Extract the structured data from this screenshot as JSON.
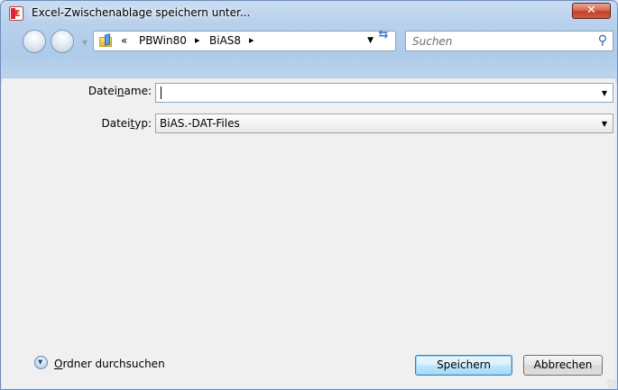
{
  "window": {
    "title": "Excel-Zwischenablage speichern unter...",
    "close_label": "✕"
  },
  "nav": {
    "breadcrumb_prefix": "«",
    "crumbs": [
      "PBWin80",
      "BiAS8"
    ],
    "search_placeholder": "Suchen"
  },
  "form": {
    "filename_label_pre": "Datei",
    "filename_label_ul": "n",
    "filename_label_post": "ame:",
    "filename_value": "",
    "filetype_label_pre": "Datei",
    "filetype_label_ul": "t",
    "filetype_label_post": "yp:",
    "filetype_value": "BiAS.-DAT-Files"
  },
  "footer": {
    "browse_ul": "O",
    "browse_rest": "rdner durchsuchen",
    "save_label": "Speichern",
    "cancel_label": "Abbrechen"
  }
}
